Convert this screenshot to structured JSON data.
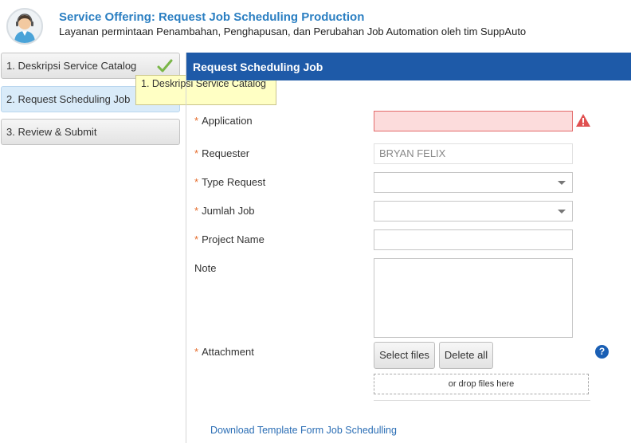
{
  "header": {
    "title": "Service Offering: Request Job Scheduling Production",
    "subtitle": "Layanan permintaan Penambahan, Penghapusan, dan Perubahan Job Automation oleh tim SuppAuto",
    "avatar_icon": "user-avatar-icon"
  },
  "steps": [
    {
      "label": "1. Deskripsi Service Catalog",
      "completed": true
    },
    {
      "label": "2. Request Scheduling Job",
      "active": true
    },
    {
      "label": "3. Review & Submit"
    }
  ],
  "tooltip": {
    "text": "1. Deskripsi Service Catalog"
  },
  "form": {
    "title": "Request Scheduling Job",
    "required_marker": "*",
    "fields": {
      "application": {
        "label": "Application",
        "value": ""
      },
      "requester": {
        "label": "Requester",
        "value": "BRYAN FELIX"
      },
      "type_request": {
        "label": "Type Request",
        "value": ""
      },
      "jumlah_job": {
        "label": "Jumlah Job",
        "value": ""
      },
      "project_name": {
        "label": "Project Name",
        "value": ""
      },
      "note": {
        "label": "Note",
        "value": ""
      },
      "attachment": {
        "label": "Attachment"
      }
    },
    "buttons": {
      "select_files": "Select files",
      "delete_all": "Delete all"
    },
    "help_icon": "?",
    "dropzone": "or drop files here",
    "download_link": "Download Template Form Job Schedulling"
  },
  "colors": {
    "title_blue": "#2b7fc2",
    "form_header_bg": "#1e5aa8",
    "error_bg": "#fcdcdc",
    "required_marker": "#e56b2a",
    "check_green": "#7ab648",
    "warning_red": "#e05050"
  }
}
